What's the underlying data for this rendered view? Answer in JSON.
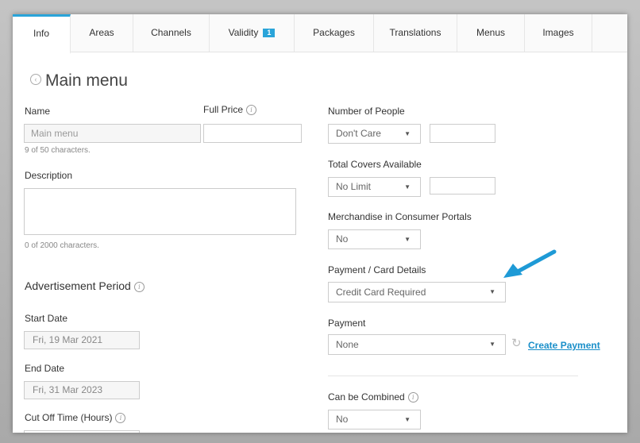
{
  "tabs": [
    {
      "label": "Info",
      "active": true
    },
    {
      "label": "Areas"
    },
    {
      "label": "Channels"
    },
    {
      "label": "Validity",
      "badge": "1"
    },
    {
      "label": "Packages"
    },
    {
      "label": "Translations"
    },
    {
      "label": "Menus"
    },
    {
      "label": "Images"
    }
  ],
  "page_title": "Main menu",
  "left": {
    "name_label": "Name",
    "name_value": "Main menu",
    "name_hint": "9 of 50 characters.",
    "full_price_label": "Full Price",
    "full_price_value": "",
    "description_label": "Description",
    "description_value": "",
    "description_hint": "0 of 2000 characters.",
    "advertisement_title": "Advertisement Period",
    "start_date_label": "Start Date",
    "start_date_value": "Fri, 19 Mar 2021",
    "end_date_label": "End Date",
    "end_date_value": "Fri, 31 Mar 2023",
    "cutoff_label": "Cut Off Time (Hours)"
  },
  "right": {
    "people_label": "Number of People",
    "people_value": "Don't Care",
    "covers_label": "Total Covers Available",
    "covers_value": "No Limit",
    "merch_label": "Merchandise in Consumer Portals",
    "merch_value": "No",
    "payment_card_label": "Payment / Card Details",
    "payment_card_value": "Credit Card Required",
    "payment_label": "Payment",
    "payment_value": "None",
    "create_payment": "Create Payment",
    "combined_label": "Can be Combined",
    "combined_value": "No"
  },
  "colors": {
    "accent": "#2aa4d9",
    "arrow": "#1e9ad6",
    "link": "#1a8fc9"
  },
  "icons": {
    "info": "info-circle-icon",
    "back": "back-circle-icon",
    "refresh": "refresh-icon",
    "caret": "caret-down-icon",
    "arrow": "callout-arrow-icon"
  }
}
